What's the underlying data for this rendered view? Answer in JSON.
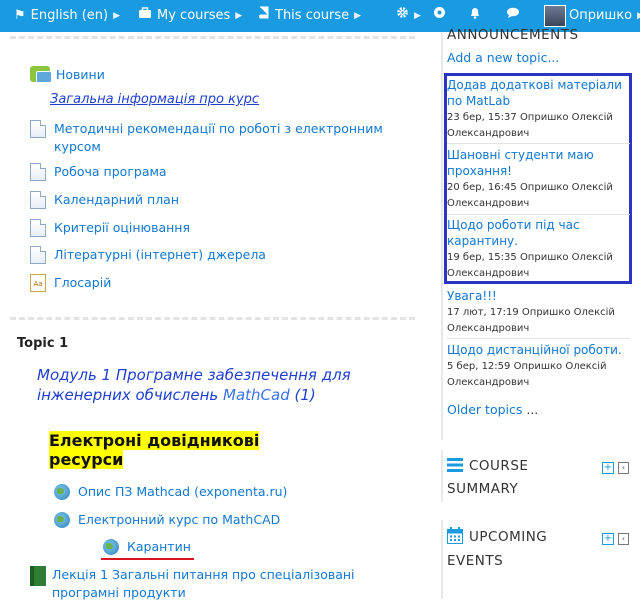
{
  "navbar": {
    "language": "English (en)",
    "my_courses": "My courses",
    "this_course": "This course",
    "user_name": "Опришко"
  },
  "main": {
    "section0": {
      "forum_label": "Новини",
      "intro_text": "Загальна інформація про курс",
      "resources": [
        {
          "label": "Методичні рекомендації по роботі з електронним курсом"
        },
        {
          "label": "Робоча програма"
        },
        {
          "label": "Календарний план"
        },
        {
          "label": "Критерії оцінювання"
        },
        {
          "label": "Літературні (інтернет) джерела"
        }
      ],
      "glossary_label": "Глосарій"
    },
    "section1": {
      "title": "Topic 1",
      "module_title_line1": "Модуль 1 Програмне забезпечення для",
      "module_title_line2a": "інженерних обчислень ",
      "module_title_mathcad": "MathCad",
      "module_title_line2b": " (1)",
      "highlight_line1": "Електроні довідникові",
      "highlight_line2": "ресурси",
      "links": [
        {
          "label": "Опис ПЗ Mathcad (exponenta.ru)"
        },
        {
          "label": "Електронний курс по MathCAD"
        }
      ],
      "quarantine_label": "Карантин",
      "lecture_label": "Лекція 1 Загальні питання про спеціалізовані програмні продукти"
    }
  },
  "announcements": {
    "header": "ANNOUNCEMENTS",
    "add_topic": "Add a new topic...",
    "items": [
      {
        "title": "Додав додаткові матеріали по MatLab",
        "date": "23 бер, 15:37",
        "author": "Опришко Олексій Олександрович"
      },
      {
        "title": "Шановні студенти маю прохання!",
        "date": "20 бер, 16:45",
        "author": "Опришко Олексій Олександрович"
      },
      {
        "title": "Щодо роботи під час карантину.",
        "date": "19 бер, 15:35",
        "author": "Опришко Олексій Олександрович"
      },
      {
        "title": "Увага!!!",
        "date": "17 лют, 17:19",
        "author": "Опришко Олексій Олександрович"
      },
      {
        "title": "Щодо дистанційної роботи.",
        "date": "5 бер, 12:59",
        "author": "Опришко Олексій Олександрович"
      }
    ],
    "older_topics": "Older topics",
    "older_suffix": " ..."
  },
  "course_summary": {
    "line1": "COURSE",
    "line2": "SUMMARY"
  },
  "upcoming_events": {
    "line1": "UPCOMING",
    "line2": "EVENTS"
  },
  "colors": {
    "navbar": "#1a9ae0",
    "link": "#1177d1",
    "highlight": "#ffff00",
    "focus_box": "#2b35c4",
    "underline": "#d9141e"
  }
}
